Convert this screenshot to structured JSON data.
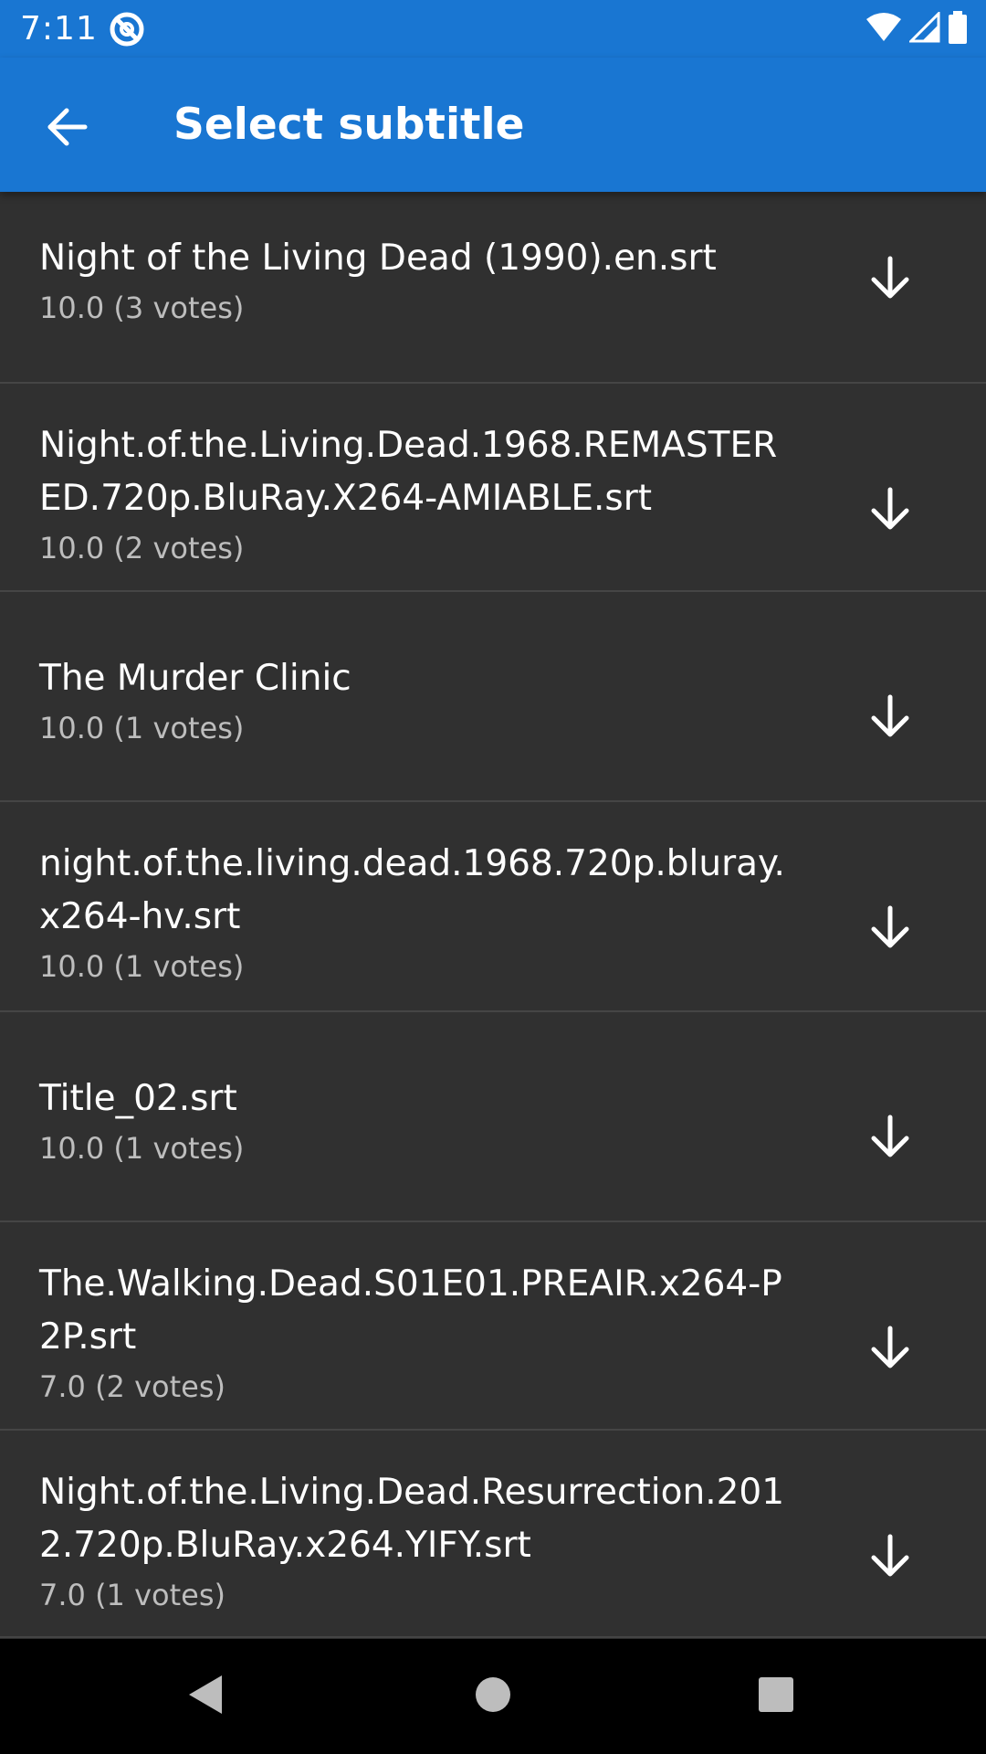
{
  "status_bar": {
    "time": "7:11",
    "icons": [
      "app-notification-icon",
      "wifi-icon",
      "signal-icon",
      "battery-icon"
    ]
  },
  "app_bar": {
    "title": "Select subtitle",
    "back_icon": "arrow-back-icon",
    "color": "#1976D2"
  },
  "subtitles": [
    {
      "title": "Night of the Living Dead (1990).en.srt",
      "rating": "10.0 (3 votes)"
    },
    {
      "title": "Night.of.the.Living.Dead.1968.REMASTERED.720p.BluRay.X264-AMIABLE.srt",
      "rating": "10.0 (2 votes)"
    },
    {
      "title": "The Murder Clinic",
      "rating": "10.0 (1 votes)"
    },
    {
      "title": "night.of.the.living.dead.1968.720p.bluray.x264-hv.srt",
      "rating": "10.0 (1 votes)"
    },
    {
      "title": "Title_02.srt",
      "rating": "10.0 (1 votes)"
    },
    {
      "title": "The.Walking.Dead.S01E01.PREAIR.x264-P2P.srt",
      "rating": "7.0 (2 votes)"
    },
    {
      "title": "Night.of.the.Living.Dead.Resurrection.2012.720p.BluRay.x264.YIFY.srt",
      "rating": "7.0 (1 votes)"
    }
  ],
  "download_icon": "arrow-down-icon",
  "nav_bar": {
    "buttons": [
      "back-triangle-icon",
      "home-circle-icon",
      "recents-square-icon"
    ]
  }
}
